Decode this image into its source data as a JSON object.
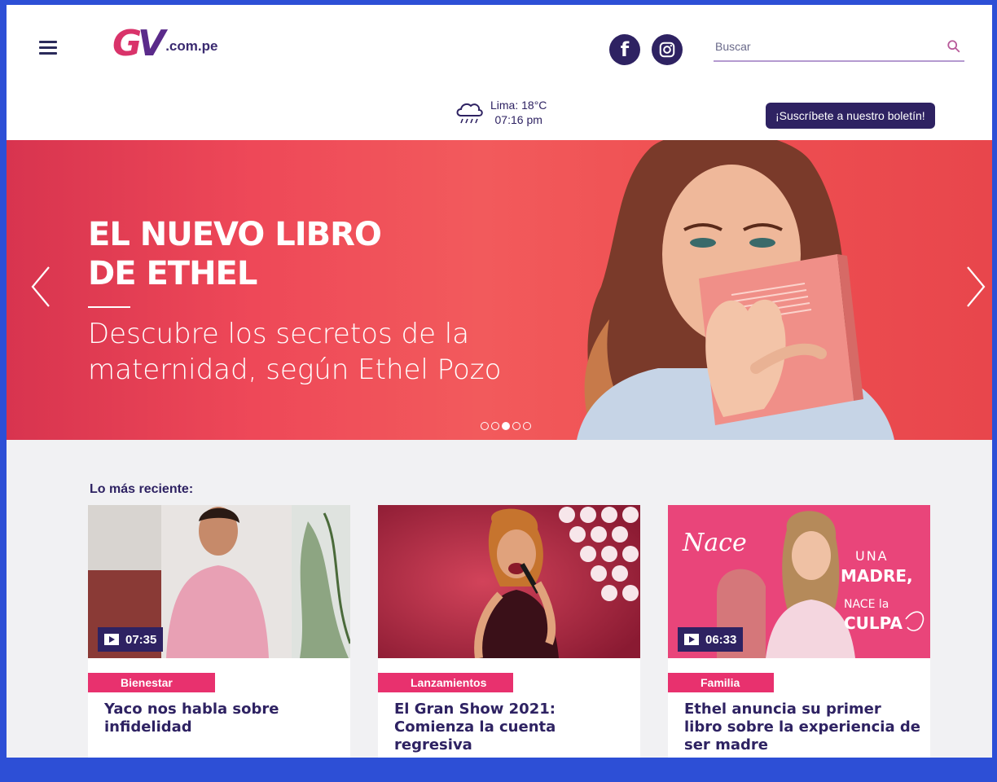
{
  "header": {
    "logo_mark": "GV",
    "logo_domain": ".com.pe",
    "search_placeholder": "Buscar",
    "weather": {
      "city_temp": "Lima: 18°C",
      "time": "07:16 pm"
    },
    "subscribe_label": "¡Suscríbete a nuestro boletín!"
  },
  "hero": {
    "title": "EL NUEVO LIBRO\nDE ETHEL",
    "subtitle": "Descubre los secretos de la maternidad, según Ethel Pozo",
    "dots_count": 5,
    "active_dot": 3
  },
  "recent": {
    "title": "Lo más reciente:",
    "cards": [
      {
        "duration": "07:35",
        "category": "Bienestar",
        "headline": "Yaco nos habla sobre infidelidad"
      },
      {
        "duration": "",
        "category": "Lanzamientos",
        "headline": "El Gran Show 2021: Comienza la cuenta regresiva"
      },
      {
        "duration": "06:33",
        "category": "Familia",
        "headline": "Ethel anuncia su primer libro sobre la experiencia de ser madre",
        "thumb_text": {
          "line1": "Nace",
          "line2": "UNA",
          "line3": "MADRE,",
          "line4": "NACE la",
          "line5": "CULPA"
        }
      }
    ]
  },
  "colors": {
    "navy": "#2e2262",
    "pink": "#e8316e",
    "hero_red": "#ee4858"
  }
}
